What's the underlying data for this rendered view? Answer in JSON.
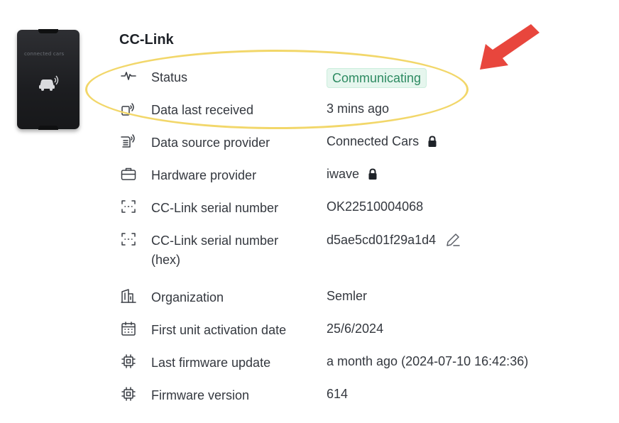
{
  "device": {
    "brand_text": "connected cars"
  },
  "title": "CC-Link",
  "rows": [
    {
      "icon": "activity-icon",
      "label": "Status",
      "value": "Communicating",
      "badge": true
    },
    {
      "icon": "signal-device-icon",
      "label": "Data last received",
      "value": "3 mins ago"
    },
    {
      "icon": "data-source-icon",
      "label": "Data source provider",
      "value": "Connected Cars",
      "locked": true
    },
    {
      "icon": "briefcase-icon",
      "label": "Hardware provider",
      "value": "iwave",
      "locked": true
    },
    {
      "icon": "scan-icon",
      "label": "CC-Link serial number",
      "value": "OK22510004068"
    },
    {
      "icon": "scan-icon",
      "label": "CC-Link serial number (hex)",
      "value": "d5ae5cd01f29a1d4",
      "editable": true
    },
    {
      "icon": "building-icon",
      "label": "Organization",
      "value": "Semler"
    },
    {
      "icon": "calendar-icon",
      "label": "First unit activation date",
      "value": "25/6/2024"
    },
    {
      "icon": "chip-icon",
      "label": "Last firmware update",
      "value": "a month ago (2024-07-10 16:42:36)"
    },
    {
      "icon": "chip-icon",
      "label": "Firmware version",
      "value": "614"
    }
  ],
  "colors": {
    "badge_bg": "#e6f6ee",
    "badge_text": "#2e8b62",
    "highlight": "#f2d76a",
    "arrow": "#e8463d"
  }
}
